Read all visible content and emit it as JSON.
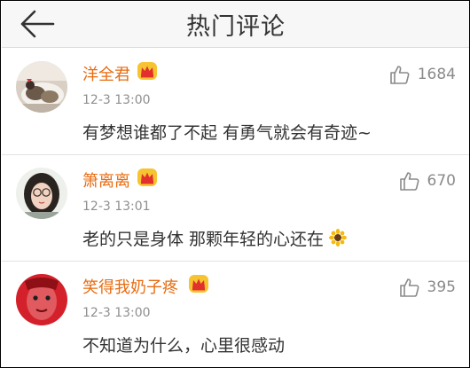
{
  "header": {
    "title": "热门评论",
    "back_icon": "back-arrow-icon"
  },
  "comments": [
    {
      "username": "洋全君",
      "badge": "vip-crown-icon",
      "time": "12-3 13:00",
      "text": "有梦想谁都了不起  有勇气就会有奇迹~",
      "likes": "1684",
      "like_icon": "thumbs-up-icon"
    },
    {
      "username": "箫离离",
      "badge": "vip-crown-icon",
      "time": "12-3 13:01",
      "text": "老的只是身体  那颗年轻的心还在",
      "emoji": "sunflower-emoji",
      "likes": "670",
      "like_icon": "thumbs-up-icon"
    },
    {
      "username": "笑得我奶子疼",
      "badge": "vip-crown-icon",
      "time": "12-3 13:00",
      "text": "不知道为什么，心里很感动",
      "likes": "395",
      "like_icon": "thumbs-up-icon"
    }
  ],
  "colors": {
    "username": "#e86b0f",
    "badge_bg": "#f7c431",
    "badge_crown": "#e2302c",
    "time": "#8f8f8f",
    "text": "#333333",
    "likes": "#8a8a8a",
    "header_bg": "#f7f7f7"
  }
}
